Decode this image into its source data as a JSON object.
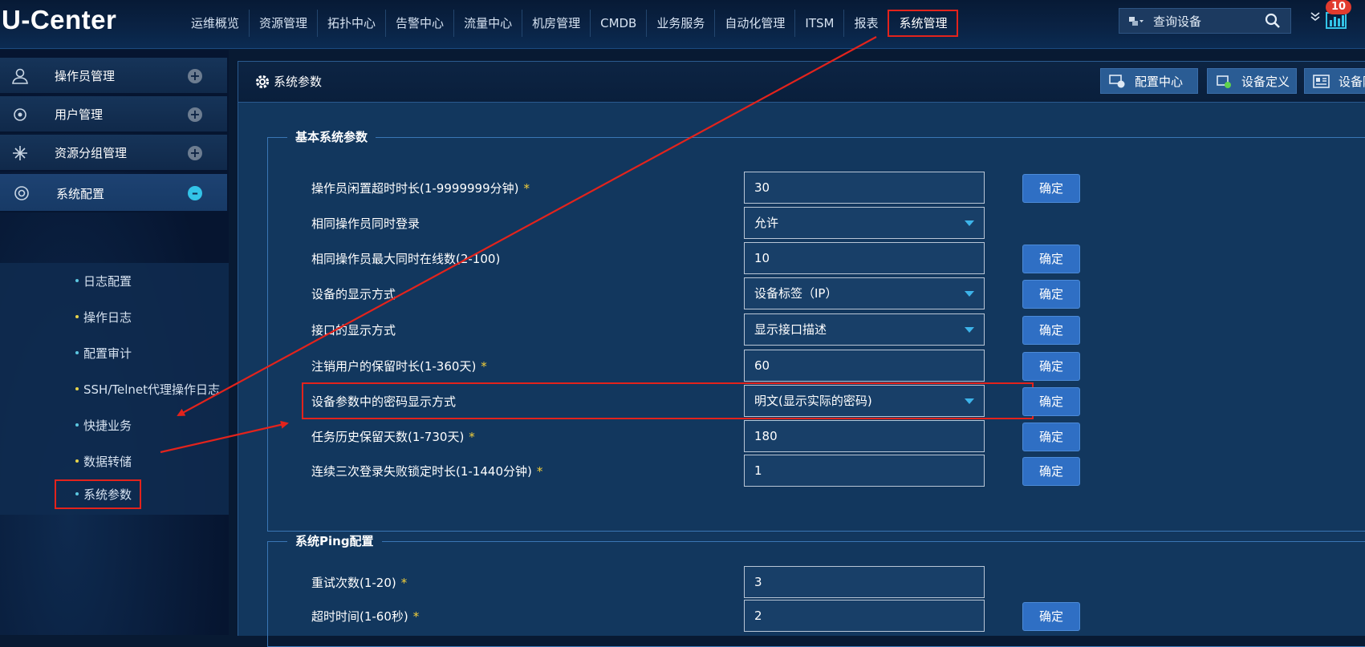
{
  "app": {
    "logo": "U-Center",
    "nav": [
      "运维概览",
      "资源管理",
      "拓扑中心",
      "告警中心",
      "流量中心",
      "机房管理",
      "CMDB",
      "业务服务",
      "自动化管理",
      "ITSM",
      "报表",
      "系统管理"
    ],
    "active_nav": "系统管理",
    "search_placeholder": "查询设备",
    "badge_count": "10"
  },
  "sidebar": {
    "groups": [
      {
        "label": "操作员管理",
        "icon": "person-icon",
        "state": "collapsed"
      },
      {
        "label": "用户管理",
        "icon": "user-settings-icon",
        "state": "collapsed"
      },
      {
        "label": "资源分组管理",
        "icon": "group-icon",
        "state": "collapsed"
      },
      {
        "label": "系统配置",
        "icon": "config-icon",
        "state": "expanded"
      }
    ],
    "sub_items": [
      "日志配置",
      "操作日志",
      "配置审计",
      "SSH/Telnet代理操作日志",
      "快捷业务",
      "数据转储",
      "系统参数"
    ],
    "selected": "系统参数"
  },
  "main": {
    "title": "系统参数",
    "toolbar": [
      {
        "label": "配置中心",
        "icon": "config-center-icon"
      },
      {
        "label": "设备定义",
        "icon": "device-define-icon"
      },
      {
        "label": "设备附",
        "icon": "device-card-icon"
      }
    ],
    "basic": {
      "legend": "基本系统参数",
      "confirm": "确定",
      "rows": [
        {
          "label": "操作员闲置超时时长(1-9999999分钟)",
          "required": true,
          "type": "input",
          "value": "30",
          "button": true
        },
        {
          "label": "相同操作员同时登录",
          "required": false,
          "type": "select",
          "value": "允许",
          "button": false
        },
        {
          "label": "相同操作员最大同时在线数(2-100)",
          "required": false,
          "type": "input",
          "value": "10",
          "button": true
        },
        {
          "label": "设备的显示方式",
          "required": false,
          "type": "select",
          "value": "设备标签（IP）",
          "button": true
        },
        {
          "label": "接口的显示方式",
          "required": false,
          "type": "select",
          "value": "显示接口描述",
          "button": true
        },
        {
          "label": "注销用户的保留时长(1-360天)",
          "required": true,
          "type": "input",
          "value": "60",
          "button": true
        },
        {
          "label": "设备参数中的密码显示方式",
          "required": false,
          "type": "select",
          "value": "明文(显示实际的密码)",
          "button": true,
          "highlight": true
        },
        {
          "label": "任务历史保留天数(1-730天)",
          "required": true,
          "type": "input",
          "value": "180",
          "button": true
        },
        {
          "label": "连续三次登录失败锁定时长(1-1440分钟)",
          "required": true,
          "type": "input",
          "value": "1",
          "button": true
        }
      ]
    },
    "ping": {
      "legend": "系统Ping配置",
      "rows": [
        {
          "label": "重试次数(1-20)",
          "required": true,
          "type": "input",
          "value": "3",
          "button": false
        },
        {
          "label": "超时时间(1-60秒)",
          "required": true,
          "type": "input",
          "value": "2",
          "button": true
        }
      ]
    }
  },
  "star": "*",
  "colors": {
    "annotation": "#e3231c",
    "button": "#2f6fc4",
    "accent": "#33c4e8"
  }
}
